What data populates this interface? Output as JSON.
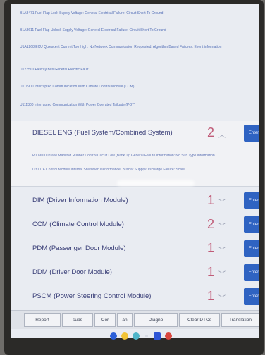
{
  "dtc_list": [
    "B1A8471 Fuel Flap Lock Supply Voltage: General Electrical Failure: Circuit Short To Ground",
    "B1A8611 Fuel Flap Unlock Supply Voltage: General Electrical Failure: Circuit Short To Ground",
    "U1A1268 ECU Quiescent Current Too High: No Network Communication Requested: Algorithm Based Failures: Event information",
    "U122500 Flexray Bus General Electric Fault",
    "U111900 Interrupted Communication With Climate Control Module (CCM)",
    "U111300 Interrupted Communication With Power Operated Tailgate (POT)"
  ],
  "modules": [
    {
      "label": "DIESEL ENG (Fuel System/Combined System)",
      "count": "2",
      "enter": "Enter"
    },
    {
      "label": "DIM (Driver Information Module)",
      "count": "1",
      "enter": "Enter"
    },
    {
      "label": "CCM (Climate Control Module)",
      "count": "2",
      "enter": "Enter"
    },
    {
      "label": "PDM (Passenger Door Module)",
      "count": "1",
      "enter": "Enter"
    },
    {
      "label": "DDM (Driver Door Module)",
      "count": "1",
      "enter": "Enter"
    },
    {
      "label": "PSCM (Power Steering Control Module)",
      "count": "1",
      "enter": "Enter"
    }
  ],
  "diesel_sub_dtcs": [
    "P009000 Intake Manifold Runner Control Circuit Low (Bank 1): General Failure Information: No Sub Type Information",
    "U3007F Control Module Internal Shutdown Performance: Busbar Supply/Discharge Failure: Scale"
  ],
  "bottom_bar": [
    "Report",
    "subs",
    "Cor",
    "an",
    "Diagno",
    "Clear DTCs",
    "Translation"
  ],
  "taskbar_icons": [
    "blue-app-icon",
    "yellow-app-icon",
    "teal-app-icon",
    "dot-icon",
    "blue-square-icon",
    "red-app-icon"
  ]
}
